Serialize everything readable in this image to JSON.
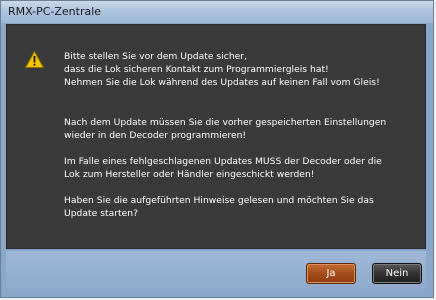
{
  "window": {
    "title": "RMX-PC-Zentrale"
  },
  "icon": {
    "name": "warning-icon",
    "color": "#f5c400"
  },
  "message": {
    "paragraph1": "Bitte stellen Sie vor dem Update sicher,\ndass die Lok sicheren Kontakt zum Programmiergleis hat!\nNehmen Sie die Lok während des Updates auf keinen Fall vom Gleis!",
    "paragraph2": "Nach dem Update müssen Sie die vorher gespeicherten Einstellungen\nwieder in den Decoder programmieren!",
    "paragraph3": "Im Falle eines fehlgeschlagenen Updates MUSS der Decoder oder die\nLok zum Hersteller oder Händler eingeschickt werden!",
    "paragraph4": "Haben Sie die aufgeführten Hinweise gelesen und möchten Sie das\nUpdate starten?"
  },
  "buttons": {
    "yes_label": "Ja",
    "no_label": "Nein"
  },
  "colors": {
    "content_background": "#3a3a3a",
    "yes_button": "#a64e1b",
    "no_button": "#333333"
  }
}
